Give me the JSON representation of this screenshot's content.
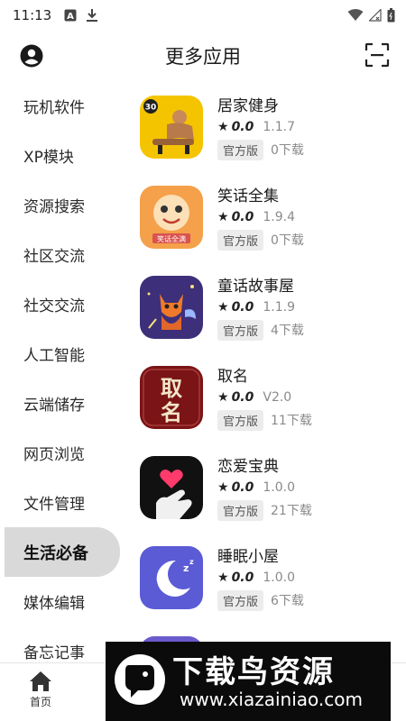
{
  "status_bar": {
    "time": "11:13"
  },
  "header": {
    "title": "更多应用"
  },
  "sidebar": {
    "items": [
      {
        "label": "玩机软件",
        "active": false
      },
      {
        "label": "XP模块",
        "active": false
      },
      {
        "label": "资源搜索",
        "active": false
      },
      {
        "label": "社区交流",
        "active": false
      },
      {
        "label": "社交交流",
        "active": false
      },
      {
        "label": "人工智能",
        "active": false
      },
      {
        "label": "云端储存",
        "active": false
      },
      {
        "label": "网页浏览",
        "active": false
      },
      {
        "label": "文件管理",
        "active": false
      },
      {
        "label": "生活必备",
        "active": true
      },
      {
        "label": "媒体编辑",
        "active": false
      },
      {
        "label": "备忘记事",
        "active": false
      }
    ]
  },
  "apps": [
    {
      "name": "居家健身",
      "rating": "0.0",
      "version": "1.1.7",
      "badge": "官方版",
      "downloads": "0下载",
      "icon": "fitness-icon",
      "icon_text": "30"
    },
    {
      "name": "笑话全集",
      "rating": "0.0",
      "version": "1.9.4",
      "badge": "官方版",
      "downloads": "0下载",
      "icon": "jokes-icon",
      "icon_text": "笑话全满"
    },
    {
      "name": "童话故事屋",
      "rating": "0.0",
      "version": "1.1.9",
      "badge": "官方版",
      "downloads": "4下载",
      "icon": "fairytale-cat-icon"
    },
    {
      "name": "取名",
      "rating": "0.0",
      "version": "V2.0",
      "badge": "官方版",
      "downloads": "11下载",
      "icon": "naming-icon",
      "icon_text": "取名"
    },
    {
      "name": "恋爱宝典",
      "rating": "0.0",
      "version": "1.0.0",
      "badge": "官方版",
      "downloads": "21下载",
      "icon": "heart-hand-icon"
    },
    {
      "name": "睡眠小屋",
      "rating": "0.0",
      "version": "1.0.0",
      "badge": "官方版",
      "downloads": "6下载",
      "icon": "moon-sleep-icon"
    }
  ],
  "bottom_nav": {
    "home_label": "首页"
  },
  "watermark": {
    "title": "下载鸟资源",
    "url": "www.xiazainiao.com"
  },
  "colors": {
    "active_bg": "#d9d9d9",
    "badge_bg": "#ececec",
    "muted_text": "#8a8a8a",
    "fitness_bg": "#f5c400",
    "jokes_bg": "#f5a04a",
    "fairytale_bg": "#3d2f7a",
    "naming_bg": "#7a1416",
    "love_bg": "#111111",
    "sleep_bg": "#5b5bd6"
  }
}
